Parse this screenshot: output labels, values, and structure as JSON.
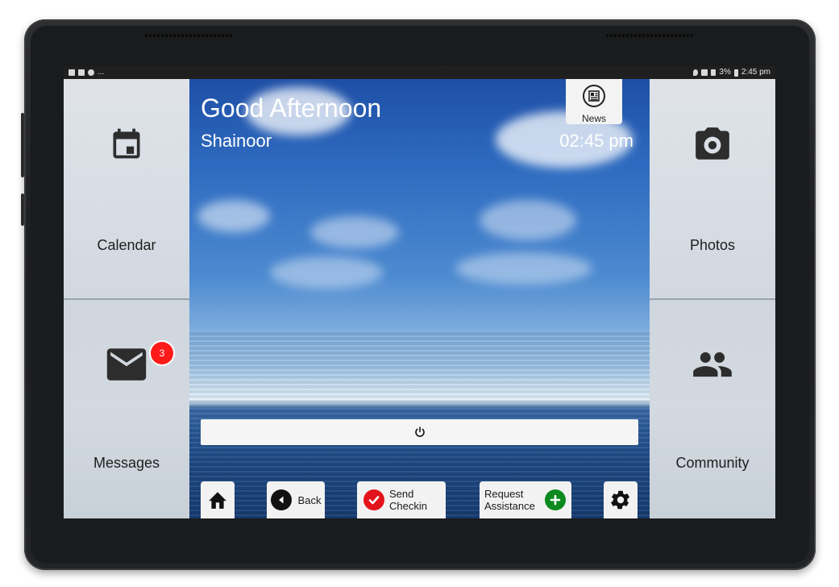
{
  "status_bar": {
    "left_overflow": "...",
    "battery": "3%",
    "time": "2:45 pm"
  },
  "tiles": {
    "calendar": {
      "label": "Calendar",
      "icon": "calendar-icon"
    },
    "photos": {
      "label": "Photos",
      "icon": "camera-icon"
    },
    "messages": {
      "label": "Messages",
      "icon": "mail-icon",
      "badge": "3"
    },
    "community": {
      "label": "Community",
      "icon": "people-icon"
    }
  },
  "header": {
    "greeting": "Good Afternoon",
    "user_name": "Shainoor",
    "time": "02:45 pm",
    "news_label": "News"
  },
  "power_icon": "power-icon",
  "bottom_nav": {
    "home_icon": "home-icon",
    "back_label": "Back",
    "checkin_line1": "Send",
    "checkin_line2": "Checkin",
    "assist_line1": "Request",
    "assist_line2": "Assistance",
    "settings_icon": "gear-icon"
  },
  "colors": {
    "badge": "#ff1a1a",
    "checkin_accent": "#e3131b",
    "assist_accent": "#0c8a1e"
  }
}
